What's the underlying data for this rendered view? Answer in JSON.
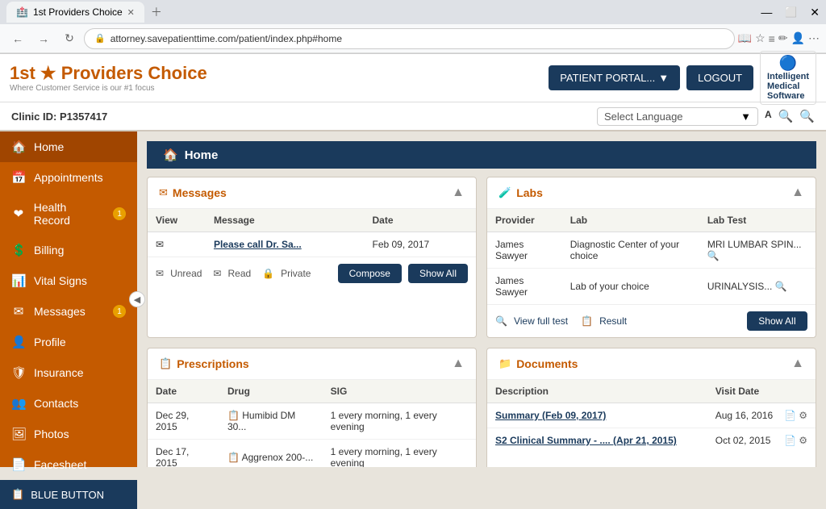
{
  "browser": {
    "tab_title": "1st Providers Choice",
    "url": "attorney.savepatienttime.com/patient/index.php#home",
    "tab_favicon": "🏥"
  },
  "header": {
    "logo_prefix": "1st",
    "logo_star": "★",
    "logo_suffix": "Providers Choice",
    "logo_sub": "Where Customer Service is our #1 focus",
    "patient_portal_label": "PATIENT PORTAL...",
    "logout_label": "LOGOUT",
    "ims_line1": "Intelligent",
    "ims_line2": "Medical",
    "ims_line3": "Software"
  },
  "clinic_bar": {
    "clinic_id": "Clinic ID: P1357417",
    "lang_placeholder": "Select Language"
  },
  "sidebar": {
    "items": [
      {
        "id": "home",
        "label": "Home",
        "icon": "🏠",
        "badge": null,
        "active": true
      },
      {
        "id": "appointments",
        "label": "Appointments",
        "icon": "📅",
        "badge": null
      },
      {
        "id": "health-record",
        "label": "Health Record",
        "icon": "❤",
        "badge": "1"
      },
      {
        "id": "billing",
        "label": "Billing",
        "icon": "💲",
        "badge": null
      },
      {
        "id": "vital-signs",
        "label": "Vital Signs",
        "icon": "📊",
        "badge": null
      },
      {
        "id": "messages",
        "label": "Messages",
        "icon": "✉",
        "badge": "1"
      },
      {
        "id": "profile",
        "label": "Profile",
        "icon": "👤",
        "badge": null
      },
      {
        "id": "insurance",
        "label": "Insurance",
        "icon": "🛡",
        "badge": null
      },
      {
        "id": "contacts",
        "label": "Contacts",
        "icon": "👥",
        "badge": null
      },
      {
        "id": "photos",
        "label": "Photos",
        "icon": "🖼",
        "badge": null
      },
      {
        "id": "facesheet",
        "label": "Facesheet",
        "icon": "📄",
        "badge": null
      }
    ],
    "blue_button": "BLUE BUTTON"
  },
  "messages_panel": {
    "title": "Messages",
    "icon": "✉",
    "columns": [
      "View",
      "Message",
      "Date"
    ],
    "rows": [
      {
        "view": "✉",
        "message": "Please call Dr. Sa...",
        "date": "Feb 09, 2017"
      }
    ],
    "footer": {
      "unread": "Unread",
      "read": "Read",
      "private": "Private",
      "compose": "Compose",
      "show_all": "Show All"
    }
  },
  "labs_panel": {
    "title": "Labs",
    "icon": "🧪",
    "columns": [
      "Provider",
      "Lab",
      "Lab Test"
    ],
    "rows": [
      {
        "provider": "James Sawyer",
        "lab": "Diagnostic Center of your choice",
        "lab_test": "MRI LUMBAR SPIN..."
      },
      {
        "provider": "James Sawyer",
        "lab": "Lab of your choice",
        "lab_test": "URINALYSIS..."
      }
    ],
    "footer": {
      "view_full_test": "View full test",
      "result": "Result",
      "show_all": "Show AlI"
    }
  },
  "prescriptions_panel": {
    "title": "Prescriptions",
    "icon": "📋",
    "columns": [
      "Date",
      "Drug",
      "SIG"
    ],
    "rows": [
      {
        "date": "Dec 29, 2015",
        "drug": "Humibid DM 30...",
        "sig": "1 every morning, 1 every evening"
      },
      {
        "date": "Dec 17, 2015",
        "drug": "Aggrenox 200-...",
        "sig": "1 every morning, 1 every evening"
      }
    ]
  },
  "documents_panel": {
    "title": "Documents",
    "icon": "📁",
    "columns": [
      "Description",
      "Visit Date"
    ],
    "rows": [
      {
        "description": "Summary (Feb 09, 2017)",
        "visit_date": "Aug 16, 2016"
      },
      {
        "description": "S2 Clinical Summary - .... (Apr 21, 2015)",
        "visit_date": "Oct 02, 2015"
      }
    ]
  }
}
